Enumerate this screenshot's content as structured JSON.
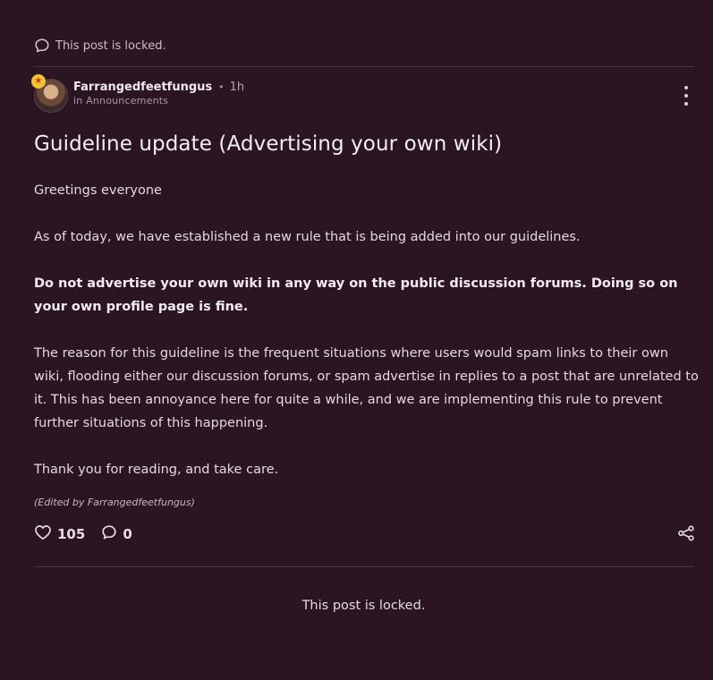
{
  "top_notice": {
    "text": "This post is locked."
  },
  "post": {
    "author": "Farrangedfeetfungus",
    "separator": "•",
    "time": "1h",
    "category_line": "in Announcements",
    "title": "Guideline update (Advertising your own wiki)",
    "paragraphs": [
      "Greetings everyone",
      "As of today, we have established a new rule that is being added into our guidelines.",
      "Do not advertise your own wiki in any way on the public discussion forums. Doing so on your own profile page is fine.",
      "The reason for this guideline is the frequent situations where users would spam links to their own wiki, flooding either our discussion forums, or spam advertise in replies to a post that are unrelated to it. This has been annoyance here for quite a while, and we are implementing this rule to prevent further situations of this happening.",
      "Thank you for reading, and take care."
    ],
    "edited_note": "(Edited by Farrangedfeetfungus)",
    "likes": "105",
    "replies": "0"
  },
  "bottom_notice": {
    "text": "This post is locked."
  },
  "icons": {
    "comment": "speech-bubble-icon",
    "like": "heart-icon",
    "share": "share-icon",
    "menu": "kebab-menu-icon"
  },
  "colors": {
    "background": "#2b1522",
    "text": "#e6dde2",
    "divider": "#4a3341"
  }
}
